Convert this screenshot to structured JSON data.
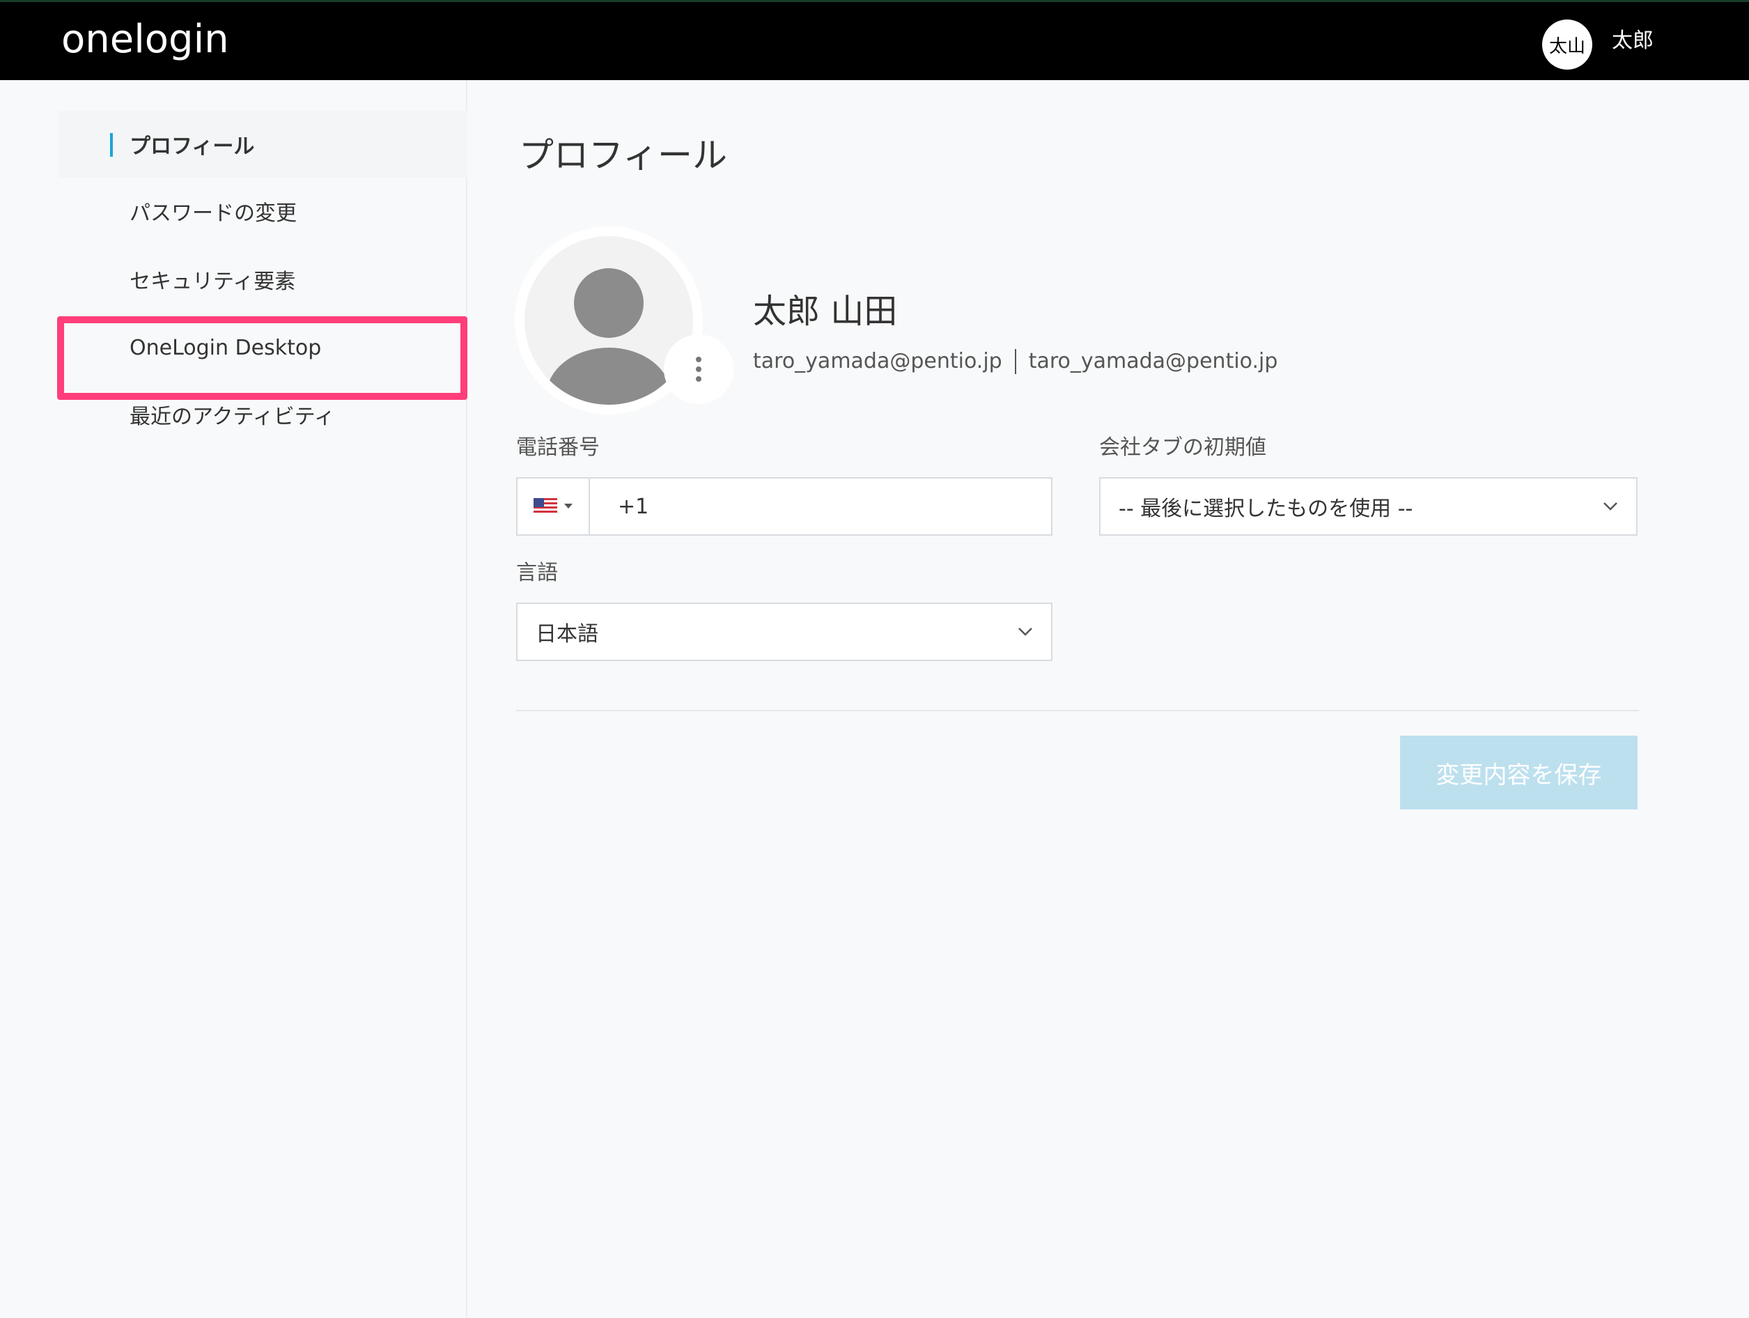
{
  "header": {
    "logo": "onelogin",
    "avatar_initials": "太山",
    "username": "太郎"
  },
  "sidebar": {
    "items": [
      {
        "label": "プロフィール",
        "active": true
      },
      {
        "label": "パスワードの変更"
      },
      {
        "label": "セキュリティ要素",
        "highlighted": true
      },
      {
        "label": "OneLogin Desktop"
      },
      {
        "label": "最近のアクティビティ"
      }
    ]
  },
  "main": {
    "title": "プロフィール",
    "user": {
      "full_name": "太郎 山田",
      "email_primary": "taro_yamada@pentio.jp",
      "email_secondary": "taro_yamada@pentio.jp"
    },
    "phone": {
      "label": "電話番号",
      "value": "+1"
    },
    "company_tab": {
      "label": "会社タブの初期値",
      "selected": "-- 最後に選択したものを使用 --"
    },
    "language": {
      "label": "言語",
      "selected": "日本語"
    },
    "save_label": "変更内容を保存"
  },
  "colors": {
    "header_bg": "#000000",
    "accent": "#1ba4d8",
    "highlight": "#ff3e7a",
    "save_disabled": "#bde0ee"
  }
}
